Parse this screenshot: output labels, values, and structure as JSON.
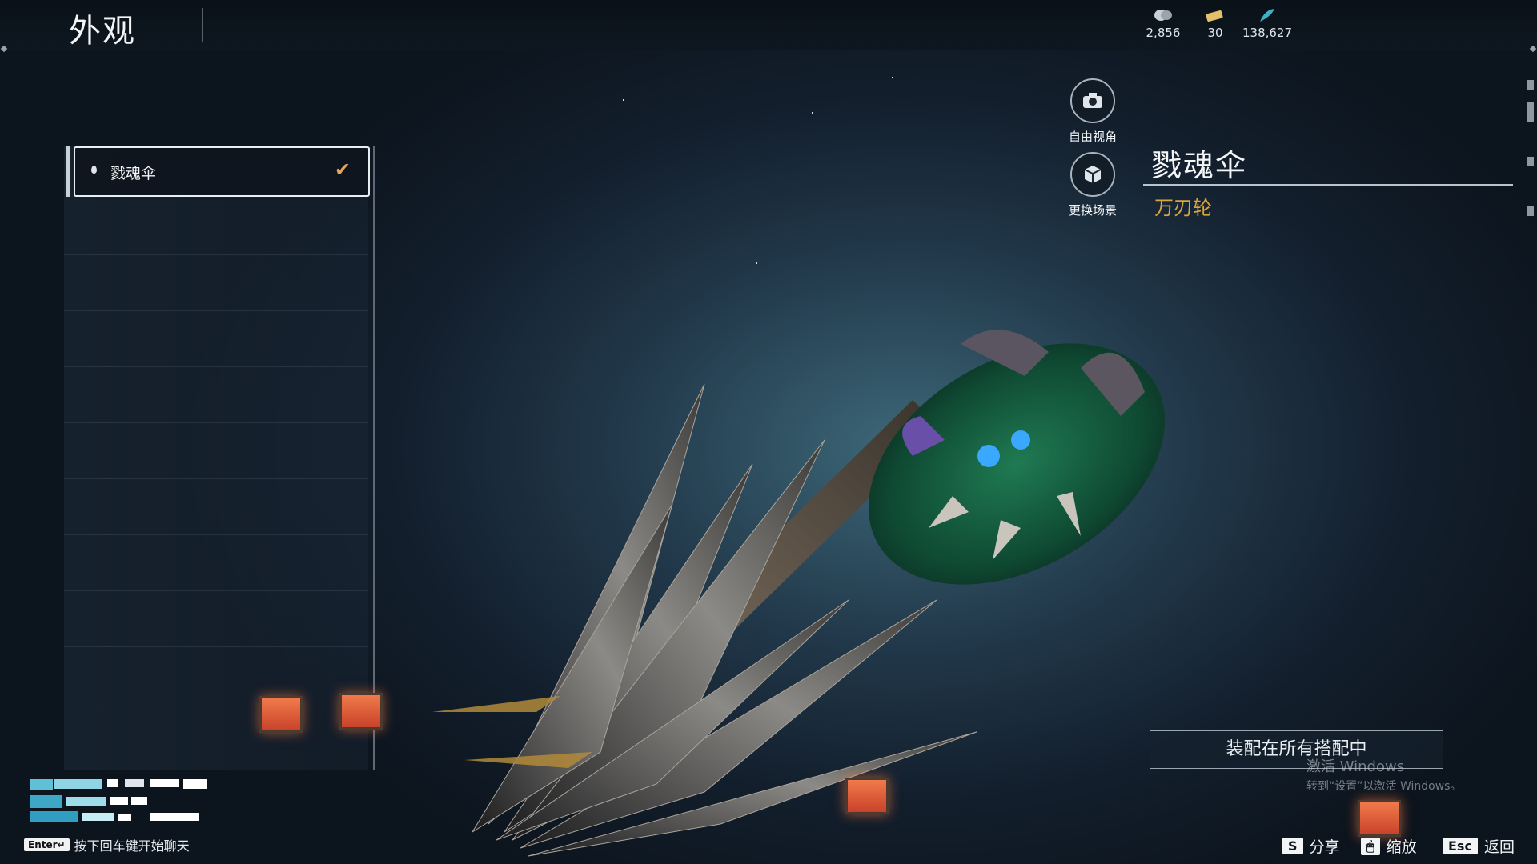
{
  "header": {
    "title": "外观",
    "currencies": [
      {
        "icon": "silver-coin-icon",
        "value": "2,856",
        "color": "#c8cfd6"
      },
      {
        "icon": "ticket-icon",
        "value": "30",
        "color": "#e2c16a"
      },
      {
        "icon": "feather-icon",
        "value": "138,627",
        "color": "#3fb0c8"
      }
    ]
  },
  "list": {
    "items": [
      {
        "name": "戮魂伞",
        "selected": true,
        "equipped": true
      }
    ]
  },
  "view_controls": {
    "free_camera": "自由视角",
    "change_scene": "更换场景"
  },
  "weapon": {
    "name": "戮魂伞",
    "type": "万刃轮"
  },
  "equip_button": "装配在所有搭配中",
  "windows_watermark": {
    "line1": "激活 Windows",
    "line2": "转到“设置”以激活 Windows。"
  },
  "chat_hint": {
    "key": "Enter↵",
    "text": "按下回车键开始聊天"
  },
  "footer": {
    "share": {
      "key": "S",
      "label": "分享"
    },
    "zoom": {
      "key": "🖱",
      "label": "缩放"
    },
    "back": {
      "key": "Esc",
      "label": "返回"
    }
  },
  "colors": {
    "accent_gold": "#d9a63e",
    "check_orange": "#e6a455"
  }
}
